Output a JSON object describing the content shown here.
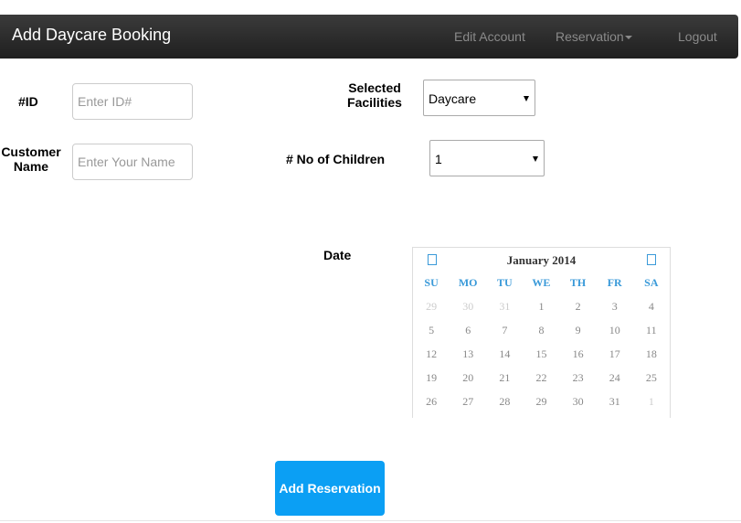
{
  "navbar": {
    "brand": "Add Daycare Booking",
    "links": [
      "Edit Account",
      "Reservation",
      "Logout"
    ]
  },
  "form": {
    "id_label": "#ID",
    "id_placeholder": "Enter ID#",
    "name_label_line1": "Customer",
    "name_label_line2": "Name",
    "name_placeholder": "Enter Your Name",
    "facilities_label_line1": "Selected",
    "facilities_label_line2": "Facilities",
    "facilities_value": "Daycare",
    "children_label": "# No of Children",
    "children_value": "1",
    "date_label": "Date",
    "submit_label": "Add Reservation"
  },
  "calendar": {
    "title": "January 2014",
    "weekdays": [
      "SU",
      "MO",
      "TU",
      "WE",
      "TH",
      "FR",
      "SA"
    ],
    "weeks": [
      [
        {
          "d": "29",
          "muted": true
        },
        {
          "d": "30",
          "muted": true
        },
        {
          "d": "31",
          "muted": true
        },
        {
          "d": "1"
        },
        {
          "d": "2"
        },
        {
          "d": "3"
        },
        {
          "d": "4"
        }
      ],
      [
        {
          "d": "5"
        },
        {
          "d": "6"
        },
        {
          "d": "7"
        },
        {
          "d": "8"
        },
        {
          "d": "9"
        },
        {
          "d": "10"
        },
        {
          "d": "11"
        }
      ],
      [
        {
          "d": "12"
        },
        {
          "d": "13"
        },
        {
          "d": "14"
        },
        {
          "d": "15"
        },
        {
          "d": "16"
        },
        {
          "d": "17"
        },
        {
          "d": "18"
        }
      ],
      [
        {
          "d": "19"
        },
        {
          "d": "20"
        },
        {
          "d": "21"
        },
        {
          "d": "22"
        },
        {
          "d": "23"
        },
        {
          "d": "24"
        },
        {
          "d": "25"
        }
      ],
      [
        {
          "d": "26"
        },
        {
          "d": "27"
        },
        {
          "d": "28"
        },
        {
          "d": "29"
        },
        {
          "d": "30"
        },
        {
          "d": "31"
        },
        {
          "d": "1",
          "muted": true
        }
      ]
    ]
  },
  "colors": {
    "accent": "#3a9ad9",
    "button": "#0b9ff4",
    "navbar": "#2b2b2b"
  }
}
